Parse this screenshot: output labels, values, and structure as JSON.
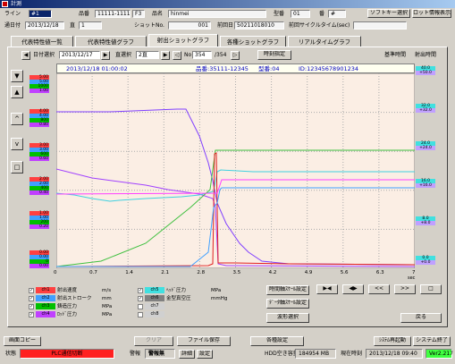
{
  "window": {
    "title": "計測"
  },
  "header": {
    "line_label": "ライン",
    "line_value": "#1",
    "part_no_label": "品番",
    "part_no_value": "11111-11111",
    "part_no_suffix": "F3",
    "part_name_label": "品名",
    "part_name_value": "hinmei",
    "die_label": "型番",
    "die_value": "01",
    "num_label": "番",
    "num_value": "#",
    "software_btn": "ソフトキー選択",
    "display_btn": "ロット情報表示",
    "date_label": "通日付",
    "date_value": "2013/12/18",
    "shift_label": "直",
    "shift_value": "1",
    "shot_label": "ショットNo.",
    "shot_value": "001",
    "prev_label": "前回日",
    "prev_value": "50211018010",
    "prev_cycle_label": "前回サイクルタイム(sec)"
  },
  "tabs": [
    "代表特性値一覧",
    "代表特性値グラフ",
    "射出ショットグラフ",
    "各種ショットグラフ",
    "リアルタイムグラフ"
  ],
  "toolbar": {
    "prev": "◀",
    "date_select_label": "日付選択",
    "date_value": "2013/12/17",
    "shift_select_label": "直選択",
    "shift_value": "2直",
    "nav_first": "▶",
    "nav_back": "◁",
    "no_label": "No",
    "no_value": "354",
    "no_total": "/354",
    "nav_fwd": "▷",
    "sync_btn": "時刻指定",
    "right_label1": "基準時間",
    "right_label2": "射出時間"
  },
  "graph": {
    "title_date": "2013/12/18 01:00:02",
    "title_part": "品番:35111-12345",
    "title_die": "型番:04",
    "title_id": "ID:12345678901234",
    "left_axis": [
      {
        "v1": "5.00",
        "v2": "5.00",
        "v3": "1000",
        "v4": "1.00"
      },
      {
        "v1": "4.00",
        "v2": "4.00",
        "v3": "800",
        "v4": "0.80"
      },
      {
        "v1": "3.00",
        "v2": "3.00",
        "v3": "600",
        "v4": "0.60"
      },
      {
        "v1": "2.00",
        "v2": "2.00",
        "v3": "400",
        "v4": "0.40"
      },
      {
        "v1": "1.00",
        "v2": "1.00",
        "v3": "200",
        "v4": "0.20"
      },
      {
        "v1": "0.00",
        "v2": "0.00",
        "v3": "0",
        "v4": "0.00"
      }
    ],
    "right_axis": [
      {
        "a": "40.0",
        "b": "+50.0"
      },
      {
        "a": "32.0",
        "b": "+32.0"
      },
      {
        "a": "24.0",
        "b": "+24.0"
      },
      {
        "a": "16.0",
        "b": "+16.0"
      },
      {
        "a": "8.0",
        "b": "+8.0"
      },
      {
        "a": "0.0",
        "b": "+0.0"
      }
    ],
    "x_ticks": [
      "0",
      "0.7",
      "1.4",
      "2.1",
      "2.8",
      "3.5",
      "4.2",
      "4.9",
      "5.6",
      "6.3",
      "7"
    ],
    "x_unit": "sec"
  },
  "legend": [
    {
      "ch": "ch1",
      "label": "射出速度",
      "unit": "m/s",
      "color": "#ff4040"
    },
    {
      "ch": "ch2",
      "label": "射出ストローク",
      "unit": "mm",
      "color": "#40a0ff"
    },
    {
      "ch": "ch3",
      "label": "鋳造圧力",
      "unit": "MPa",
      "color": "#00c000"
    },
    {
      "ch": "ch4",
      "label": "ﾛｯﾄﾞ圧力",
      "unit": "MPa",
      "color": "#c040ff"
    },
    {
      "ch": "ch5",
      "label": "ﾍｯﾄﾞ圧力",
      "unit": "MPa",
      "color": "#40e0e0"
    },
    {
      "ch": "ch6",
      "label": "金型真空圧",
      "unit": "mmHg",
      "color": "#808080"
    },
    {
      "ch": "ch7",
      "label": "",
      "unit": "",
      "color": "#d0d0d0"
    },
    {
      "ch": "ch8",
      "label": "",
      "unit": "",
      "color": "#d0d0d0"
    }
  ],
  "controls": {
    "time_axis_btn": "時間軸ｽｹｰﾙ設定",
    "data_axis_btn": "ﾃﾞｰﾀ軸ｽｹｰﾙ設定",
    "wave_btn": "波形選択",
    "b1": "▶◀",
    "b2": "◀▶",
    "b3": "<<",
    "b4": ">>",
    "b5": "□",
    "back": "戻る"
  },
  "bottom": {
    "copy": "画面コピー",
    "clear": "クリア",
    "save": "ファイル保存",
    "settings": "各種設定",
    "sys_restart": "ｼｽﾃﾑ再起動",
    "sys_exit": "システム終了"
  },
  "status": {
    "state_label": "状態",
    "state_value": "PLC通信切断",
    "alarm_label": "警報",
    "alarm_value": "警報無",
    "btn1": "詳細",
    "btn2": "設定",
    "hdd_label": "HDD空き容量",
    "hdd_value": "184954 MB",
    "time_label": "現在時刻",
    "time_value": "2013/12/18 09:40",
    "version": "Ver2.217"
  }
}
